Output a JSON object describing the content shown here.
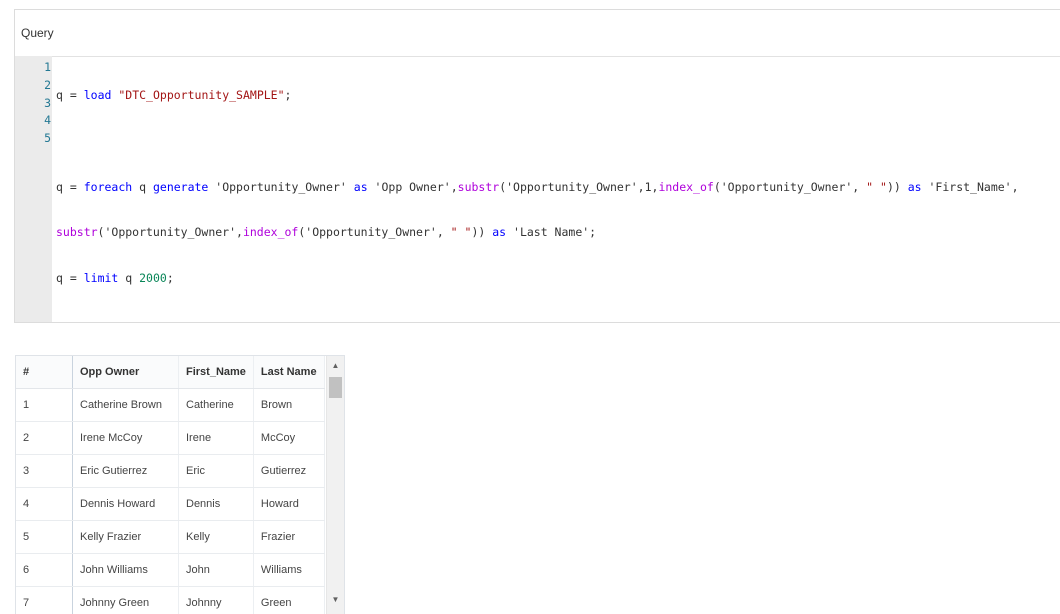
{
  "query": {
    "label": "Query",
    "lines": [
      {
        "number": "1"
      },
      {
        "number": "2"
      },
      {
        "number": "3"
      },
      {
        "number": "4"
      },
      {
        "number": "5"
      }
    ],
    "tokens": {
      "l1_var": "q",
      "l1_eq": " = ",
      "l1_kw": "load",
      "l1_str": "\"DTC_Opportunity_SAMPLE\"",
      "l1_end": ";",
      "l3_var": "q",
      "l3_eq": " = ",
      "l3_kw1": "foreach",
      "l3_var2": " q ",
      "l3_kw2": "generate",
      "l3_t1": " 'Opportunity_Owner' ",
      "l3_kw3": "as",
      "l3_t2": " 'Opp Owner',",
      "l3_fn1": "substr",
      "l3_t3": "('Opportunity_Owner',1,",
      "l3_fn2": "index_of",
      "l3_t4": "('Opportunity_Owner', ",
      "l3_str1": "\" \"",
      "l3_t5": ")) ",
      "l3_kw4": "as",
      "l3_t6": " 'First_Name',",
      "l4_fn1": "substr",
      "l4_t1": "('Opportunity_Owner',",
      "l4_fn2": "index_of",
      "l4_t2": "('Opportunity_Owner', ",
      "l4_str1": "\" \"",
      "l4_t3": ")) ",
      "l4_kw1": "as",
      "l4_t4": " 'Last Name';",
      "l5_var": "q",
      "l5_eq": " = ",
      "l5_kw": "limit",
      "l5_var2": " q ",
      "l5_num": "2000",
      "l5_end": ";"
    }
  },
  "results": {
    "columns": [
      "#",
      "Opp Owner",
      "First_Name",
      "Last Name"
    ],
    "rows": [
      {
        "idx": "1",
        "opp": "Catherine Brown",
        "first": "Catherine",
        "last": "Brown"
      },
      {
        "idx": "2",
        "opp": "Irene McCoy",
        "first": "Irene",
        "last": "McCoy"
      },
      {
        "idx": "3",
        "opp": "Eric Gutierrez",
        "first": "Eric",
        "last": "Gutierrez"
      },
      {
        "idx": "4",
        "opp": "Dennis Howard",
        "first": "Dennis",
        "last": "Howard"
      },
      {
        "idx": "5",
        "opp": "Kelly Frazier",
        "first": "Kelly",
        "last": "Frazier"
      },
      {
        "idx": "6",
        "opp": "John Williams",
        "first": "John",
        "last": "Williams"
      },
      {
        "idx": "7",
        "opp": "Johnny Green",
        "first": "Johnny",
        "last": "Green"
      }
    ]
  },
  "icons": {
    "scroll_up": "▲",
    "scroll_down": "▼"
  }
}
